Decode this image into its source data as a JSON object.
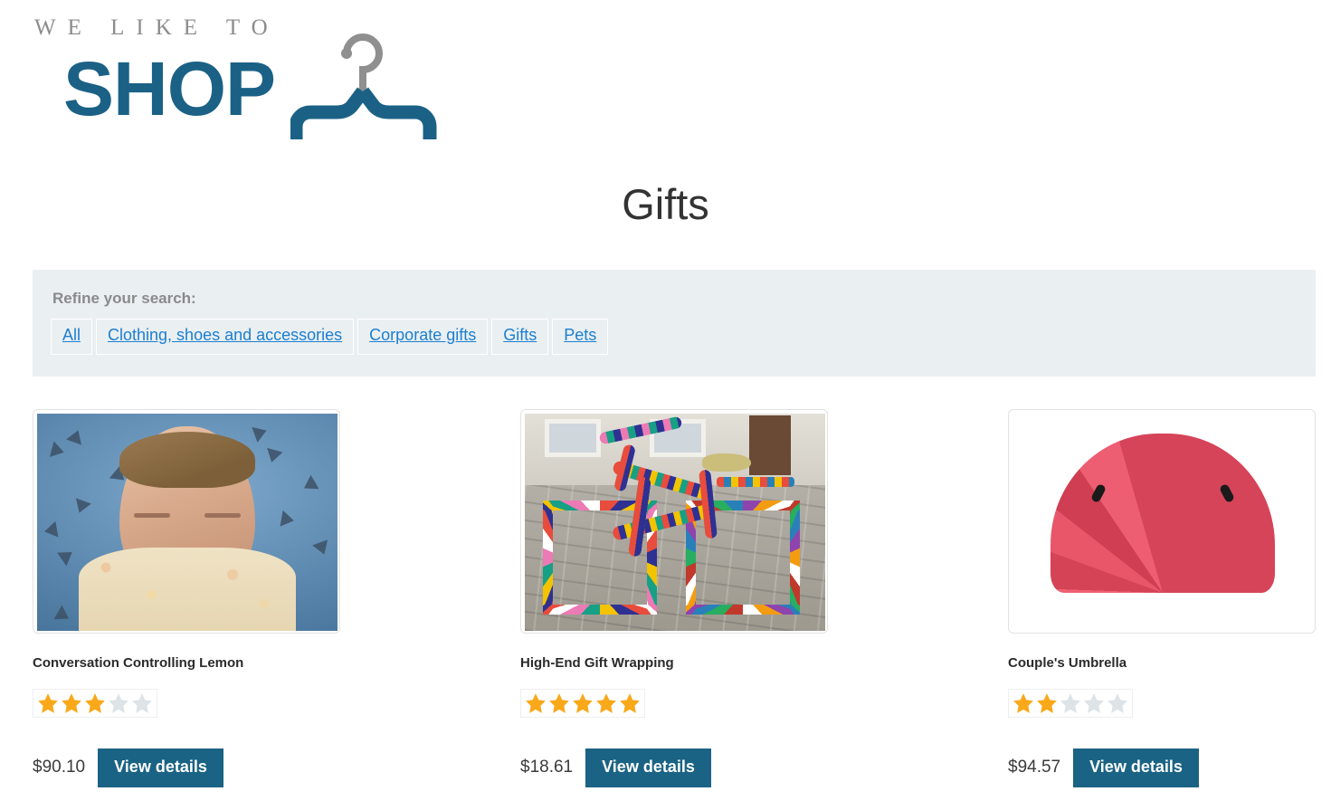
{
  "brand": {
    "tagline": "WE LIKE TO",
    "word": "SHOP",
    "icon": "clothes-hanger-icon",
    "tagline_color": "#8c8c8c",
    "word_color": "#1b6186"
  },
  "page": {
    "title": "Gifts"
  },
  "filter": {
    "label": "Refine your search:",
    "background_color": "#eaeff2",
    "link_color": "#1b7fd0",
    "options": [
      {
        "label": "All",
        "selected": false
      },
      {
        "label": "Clothing, shoes and accessories",
        "selected": false
      },
      {
        "label": "Corporate gifts",
        "selected": false
      },
      {
        "label": "Gifts",
        "selected": false
      },
      {
        "label": "Pets",
        "selected": false
      }
    ]
  },
  "products": [
    {
      "title": "Conversation Controlling Lemon",
      "rating": 3,
      "max_rating": 5,
      "price": "$90.10",
      "button_label": "View details",
      "image_alt": "man-grimacing-with-lemon-in-mouth"
    },
    {
      "title": "High-End Gift Wrapping",
      "rating": 5,
      "max_rating": 5,
      "price": "$18.61",
      "button_label": "View details",
      "image_alt": "yarn-bombed-colorful-knitted-bicycle"
    },
    {
      "title": "Couple's Umbrella",
      "rating": 2,
      "max_rating": 5,
      "price": "$94.57",
      "button_label": "View details",
      "image_alt": "red-couples-umbrella"
    }
  ],
  "theme": {
    "button_color": "#1b6384",
    "star_filled_color": "#f9a81a",
    "star_empty_color": "#dde3e6",
    "title_color": "#333333"
  }
}
